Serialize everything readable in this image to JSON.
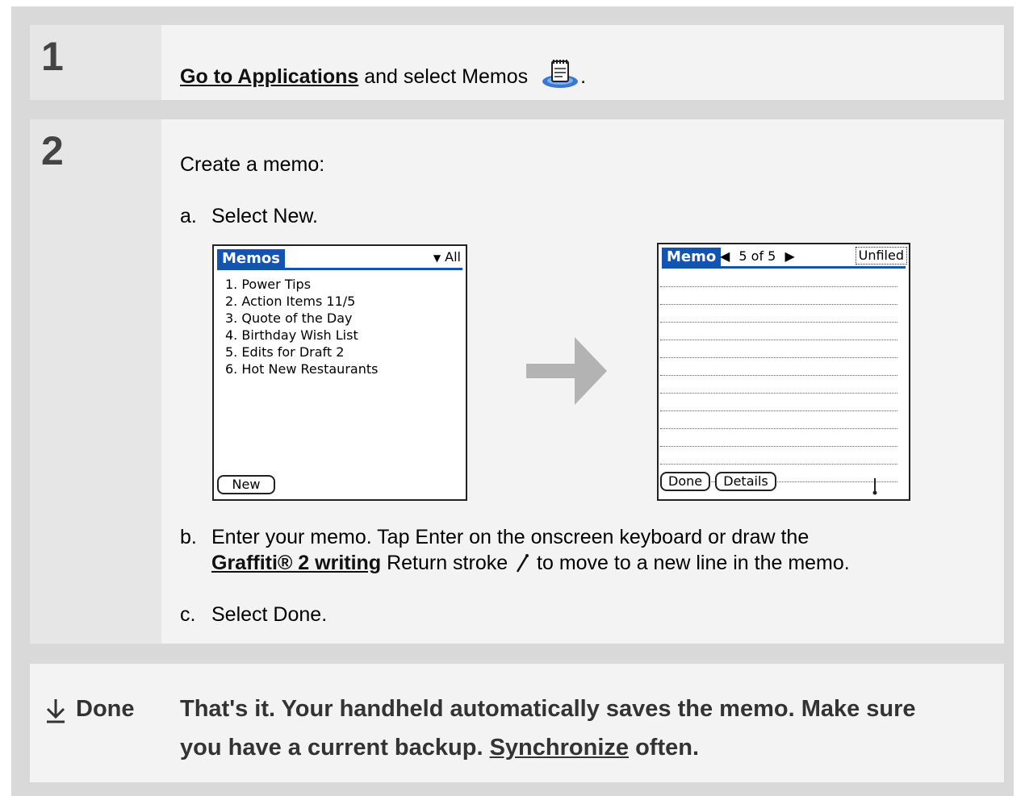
{
  "step1": {
    "number": "1",
    "link": "Go to Applications",
    "text": "and select Memos",
    "period": "."
  },
  "step2": {
    "number": "2",
    "intro": "Create a memo:",
    "a_marker": "a.",
    "a_text": "Select New.",
    "b_marker": "b.",
    "b_line1": "Enter your memo. Tap Enter on the onscreen keyboard or draw the",
    "b_link": "Graffiti® 2 writing",
    "b_line2_mid": "Return stroke",
    "b_line2_end": "to move to a new line in the memo.",
    "c_marker": "c.",
    "c_text": "Select Done."
  },
  "memos_screen": {
    "title": "Memos",
    "category": "All",
    "items": [
      "1. Power Tips",
      "2. Action Items 11/5",
      "3. Quote of the Day",
      "4. Birthday Wish List",
      "5. Edits for Draft 2",
      "6. Hot New Restaurants"
    ],
    "new_button": "New"
  },
  "memo_screen": {
    "title": "Memo",
    "position": "5 of 5",
    "category": "Unfiled",
    "done_button": "Done",
    "details_button": "Details"
  },
  "done": {
    "label": "Done",
    "line1": "That's it. Your handheld automatically saves the memo. Make sure",
    "line2_pre": "you have a current backup.",
    "line2_link": "Synchronize",
    "line2_post": "often."
  },
  "colors": {
    "palm_blue": "#1254b4",
    "frame_gray": "#d9d9d9",
    "arrow_gray": "#b3b3b3"
  }
}
